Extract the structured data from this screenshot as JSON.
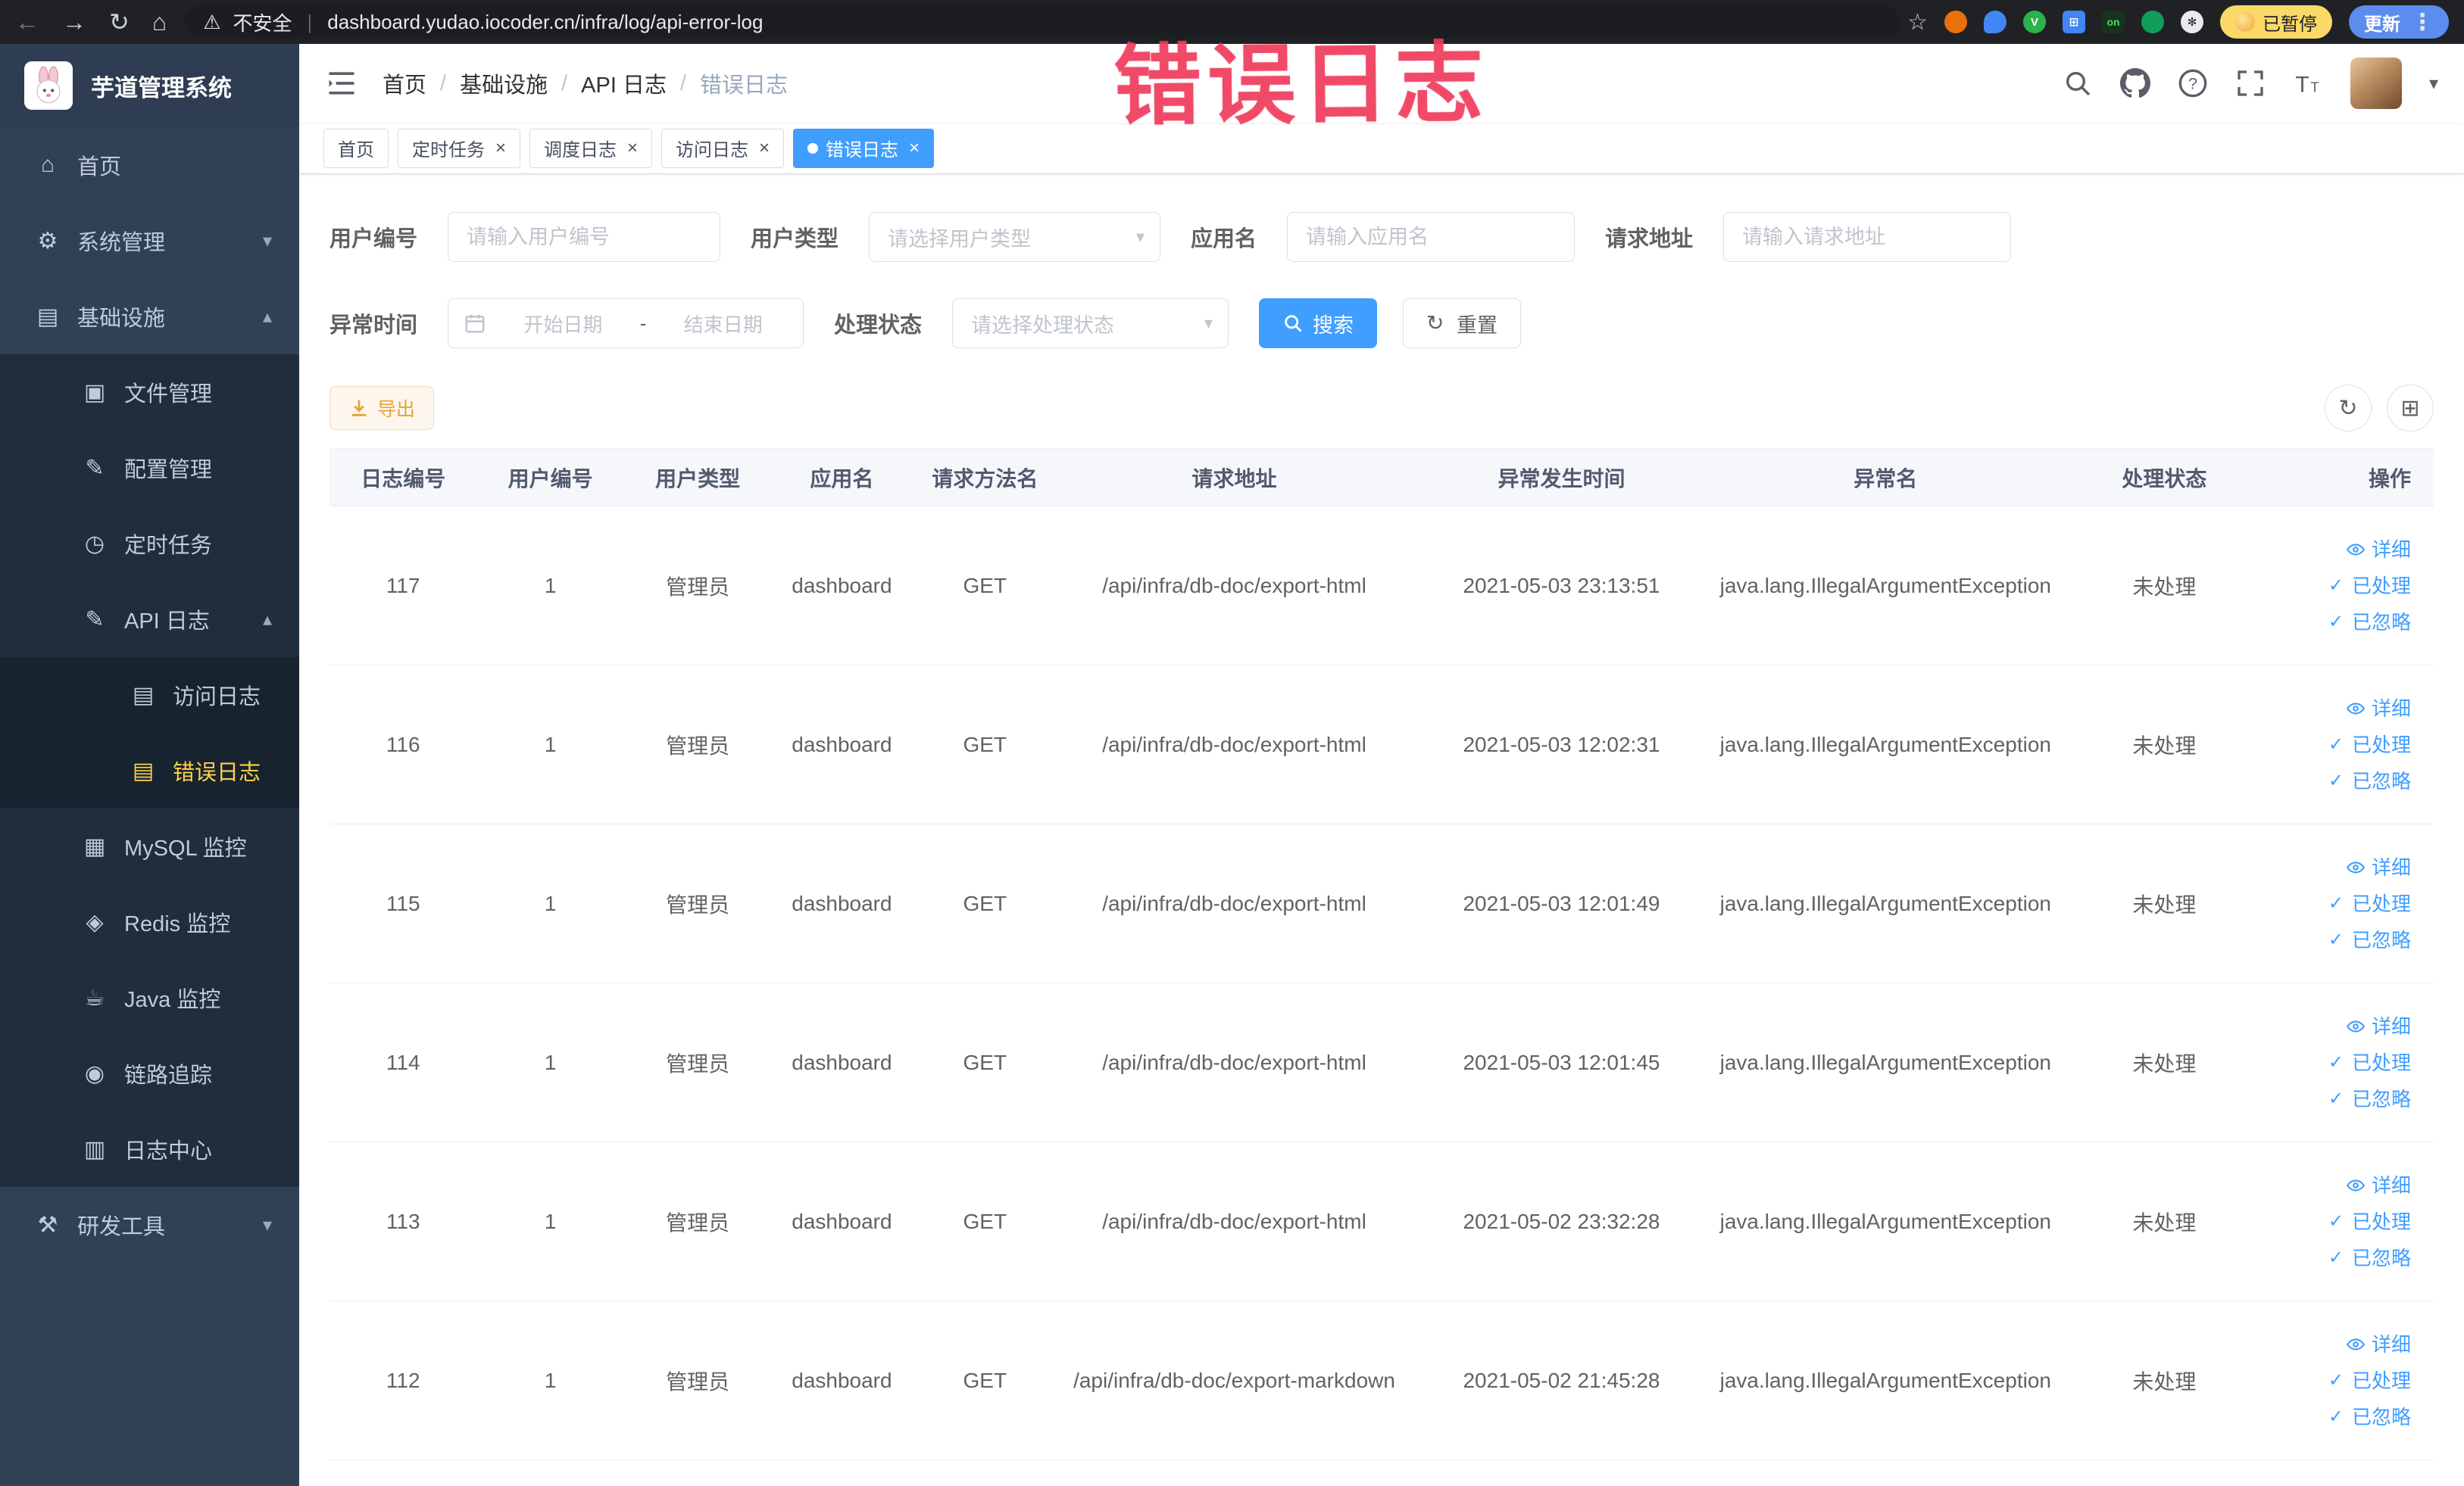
{
  "watermark": "错误日志",
  "browser": {
    "security_label": "不安全",
    "url": "dashboard.yudao.iocoder.cn/infra/log/api-error-log",
    "paused_label": "已暂停",
    "update_label": "更新",
    "ext_on_label": "on",
    "ext_v_label": "V",
    "nav_icons": [
      "back",
      "forward",
      "refresh",
      "home"
    ],
    "extension_icons": [
      "star",
      "ext-orange",
      "ext-drop",
      "ext-green-v",
      "ext-grid",
      "ext-on",
      "ext-leaf",
      "ext-paw"
    ]
  },
  "sidebar": {
    "logo_title": "芋道管理系统",
    "items": [
      {
        "name": "home",
        "icon": "home",
        "label": "首页",
        "level": 1
      },
      {
        "name": "system-mgmt",
        "icon": "gear",
        "label": "系统管理",
        "level": 1,
        "chevron": "down"
      },
      {
        "name": "infrastructure",
        "icon": "monitor",
        "label": "基础设施",
        "level": 1,
        "chevron": "up"
      },
      {
        "name": "file-mgmt",
        "icon": "folder",
        "label": "文件管理",
        "level": 2
      },
      {
        "name": "config-mgmt",
        "icon": "edit",
        "label": "配置管理",
        "level": 2
      },
      {
        "name": "scheduled-jobs",
        "icon": "timer",
        "label": "定时任务",
        "level": 2
      },
      {
        "name": "api-logs",
        "icon": "edit-square",
        "label": "API 日志",
        "level": 2,
        "chevron": "up"
      },
      {
        "name": "access-log",
        "icon": "document",
        "label": "访问日志",
        "level": 3
      },
      {
        "name": "error-log",
        "icon": "document",
        "label": "错误日志",
        "level": 3,
        "active": true
      },
      {
        "name": "mysql-monitor",
        "icon": "database",
        "label": "MySQL 监控",
        "level": 2
      },
      {
        "name": "redis-monitor",
        "icon": "redis",
        "label": "Redis 监控",
        "level": 2
      },
      {
        "name": "java-monitor",
        "icon": "java",
        "label": "Java 监控",
        "level": 2
      },
      {
        "name": "tracing",
        "icon": "eye",
        "label": "链路追踪",
        "level": 2
      },
      {
        "name": "log-center",
        "icon": "log",
        "label": "日志中心",
        "level": 2
      },
      {
        "name": "dev-tools",
        "icon": "tools",
        "label": "研发工具",
        "level": 1,
        "chevron": "down"
      }
    ]
  },
  "header": {
    "breadcrumb": [
      "首页",
      "基础设施",
      "API 日志",
      "错误日志"
    ],
    "icons": [
      "search",
      "github",
      "help",
      "fullscreen",
      "font-size"
    ]
  },
  "tabs": [
    {
      "name": "home",
      "label": "首页",
      "closable": false,
      "active": false
    },
    {
      "name": "scheduled-jobs",
      "label": "定时任务",
      "closable": true,
      "active": false
    },
    {
      "name": "schedule-log",
      "label": "调度日志",
      "closable": true,
      "active": false
    },
    {
      "name": "access-log",
      "label": "访问日志",
      "closable": true,
      "active": false
    },
    {
      "name": "error-log",
      "label": "错误日志",
      "closable": true,
      "active": true
    }
  ],
  "filters": {
    "user_id_label": "用户编号",
    "user_id_placeholder": "请输入用户编号",
    "user_type_label": "用户类型",
    "user_type_placeholder": "请选择用户类型",
    "app_name_label": "应用名",
    "app_name_placeholder": "请输入应用名",
    "request_url_label": "请求地址",
    "request_url_placeholder": "请输入请求地址",
    "exception_time_label": "异常时间",
    "date_start_placeholder": "开始日期",
    "date_separator": "-",
    "date_end_placeholder": "结束日期",
    "process_status_label": "处理状态",
    "process_status_placeholder": "请选择处理状态",
    "search_label": "搜索",
    "reset_label": "重置"
  },
  "toolbar": {
    "export_label": "导出"
  },
  "table": {
    "headers": [
      "日志编号",
      "用户编号",
      "用户类型",
      "应用名",
      "请求方法名",
      "请求地址",
      "异常发生时间",
      "异常名",
      "处理状态",
      "操作"
    ],
    "action_labels": {
      "detail": "详细",
      "processed": "已处理",
      "ignored": "已忽略"
    },
    "rows": [
      {
        "id": "117",
        "user_id": "1",
        "user_type": "管理员",
        "app": "dashboard",
        "method": "GET",
        "url": "/api/infra/db-doc/export-html",
        "time": "2021-05-03 23:13:51",
        "exception": "java.lang.IllegalArgumentException",
        "status": "未处理"
      },
      {
        "id": "116",
        "user_id": "1",
        "user_type": "管理员",
        "app": "dashboard",
        "method": "GET",
        "url": "/api/infra/db-doc/export-html",
        "time": "2021-05-03 12:02:31",
        "exception": "java.lang.IllegalArgumentException",
        "status": "未处理"
      },
      {
        "id": "115",
        "user_id": "1",
        "user_type": "管理员",
        "app": "dashboard",
        "method": "GET",
        "url": "/api/infra/db-doc/export-html",
        "time": "2021-05-03 12:01:49",
        "exception": "java.lang.IllegalArgumentException",
        "status": "未处理"
      },
      {
        "id": "114",
        "user_id": "1",
        "user_type": "管理员",
        "app": "dashboard",
        "method": "GET",
        "url": "/api/infra/db-doc/export-html",
        "time": "2021-05-03 12:01:45",
        "exception": "java.lang.IllegalArgumentException",
        "status": "未处理"
      },
      {
        "id": "113",
        "user_id": "1",
        "user_type": "管理员",
        "app": "dashboard",
        "method": "GET",
        "url": "/api/infra/db-doc/export-html",
        "time": "2021-05-02 23:32:28",
        "exception": "java.lang.IllegalArgumentException",
        "status": "未处理"
      },
      {
        "id": "112",
        "user_id": "1",
        "user_type": "管理员",
        "app": "dashboard",
        "method": "GET",
        "url": "/api/infra/db-doc/export-markdown",
        "time": "2021-05-02 21:45:28",
        "exception": "java.lang.IllegalArgumentException",
        "status": "未处理"
      }
    ]
  }
}
